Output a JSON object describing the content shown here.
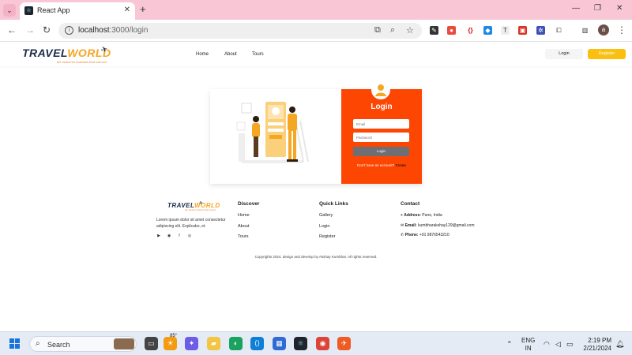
{
  "browser": {
    "tab_title": "React App",
    "url_host": "localhost",
    "url_path": ":3000/login",
    "new_tab": "+",
    "close_tab": "✕",
    "profile_initial": "a"
  },
  "site": {
    "logo_left": "TRAVEL",
    "logo_right": "WORLD",
    "logo_tagline": "the virtual for business that connect",
    "nav": [
      "Home",
      "About",
      "Tours"
    ],
    "login_label": "Login",
    "register_label": "Register"
  },
  "login_form": {
    "title": "Login",
    "email_placeholder": "Email",
    "password_placeholder": "Password",
    "submit_label": "Login",
    "no_account_text": "Don't have an account?",
    "create_label": "Create"
  },
  "footer": {
    "description": "Lorem ipsum dolor sit amet consectetur adipiscing elit. Explicabo, et.",
    "discover": {
      "title": "Discover",
      "links": [
        "Home",
        "About",
        "Tours"
      ]
    },
    "quick_links": {
      "title": "Quick Links",
      "links": [
        "Gallery",
        "Login",
        "Register"
      ]
    },
    "contact": {
      "title": "Contact",
      "address_label": "Address:",
      "address_value": "Pune, India",
      "email_label": "Email:",
      "email_value": "kumbharakshay129@gmail.com",
      "phone_label": "Phone:",
      "phone_value": "+91 9876543210"
    },
    "copyright": "Copyrights 2024, design and develop by Akshay Kumbhar. All rights reserved."
  },
  "taskbar": {
    "search_label": "Search",
    "weather_temp": "85°",
    "lang_line1": "ENG",
    "lang_line2": "IN",
    "time": "2:19 PM",
    "date": "2/21/2024"
  },
  "colors": {
    "login_panel": "#fe4603",
    "register_button": "#fbbf10",
    "logo_navy": "#1d2b4a",
    "logo_accent": "#f5a623"
  }
}
